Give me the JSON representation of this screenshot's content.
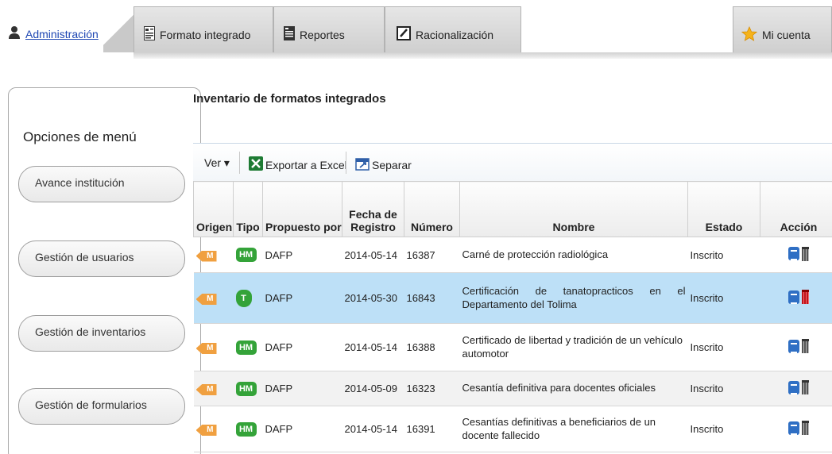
{
  "tabs": {
    "administracion": "Administración",
    "formato": "Formato integrado",
    "reportes": "Reportes",
    "racionalizacion": "Racionalización",
    "cuenta": "Mi cuenta"
  },
  "sidebar": {
    "title": "Opciones de menú",
    "items": [
      "Avance institución",
      "Gestión de usuarios",
      "Gestión de inventarios",
      "Gestión de formularios"
    ]
  },
  "main": {
    "title": "Inventario de formatos integrados"
  },
  "toolbar": {
    "ver": "Ver ▾",
    "exportar": "Exportar a Excel",
    "separar": "Separar"
  },
  "table": {
    "headers": {
      "origen": "Origen",
      "tipo": "Tipo",
      "propuesto": "Propuesto por",
      "fecha": "Fecha de Registro",
      "numero": "Número",
      "nombre": "Nombre",
      "estado": "Estado",
      "accion": "Acción"
    },
    "rows": [
      {
        "origen": "M",
        "tipo": "HM",
        "propuesto": "DAFP",
        "fecha": "2014-05-14",
        "numero": "16387",
        "nombre": "Carné de protección radiológica",
        "estado": "Inscrito"
      },
      {
        "origen": "M",
        "tipo": "T",
        "propuesto": "DAFP",
        "fecha": "2014-05-30",
        "numero": "16843",
        "nombre": "Certificación de tanatopracticos en el Departamento del Tolima",
        "estado": "Inscrito"
      },
      {
        "origen": "M",
        "tipo": "HM",
        "propuesto": "DAFP",
        "fecha": "2014-05-14",
        "numero": "16388",
        "nombre": "Certificado de libertad y tradición de un vehículo automotor",
        "estado": "Inscrito"
      },
      {
        "origen": "M",
        "tipo": "HM",
        "propuesto": "DAFP",
        "fecha": "2014-05-09",
        "numero": "16323",
        "nombre": "Cesantía definitiva para docentes oficiales",
        "estado": "Inscrito"
      },
      {
        "origen": "M",
        "tipo": "HM",
        "propuesto": "DAFP",
        "fecha": "2014-05-14",
        "numero": "16391",
        "nombre": "Cesantías definitivas a beneficiarios de un docente fallecido",
        "estado": "Inscrito"
      }
    ]
  },
  "colors": {
    "active_tab_text": "#1d46b3",
    "selected_row": "#bde0f7",
    "badge_green": "#34a339",
    "badge_orange": "#f0a040",
    "delete_red": "#c0121b"
  }
}
